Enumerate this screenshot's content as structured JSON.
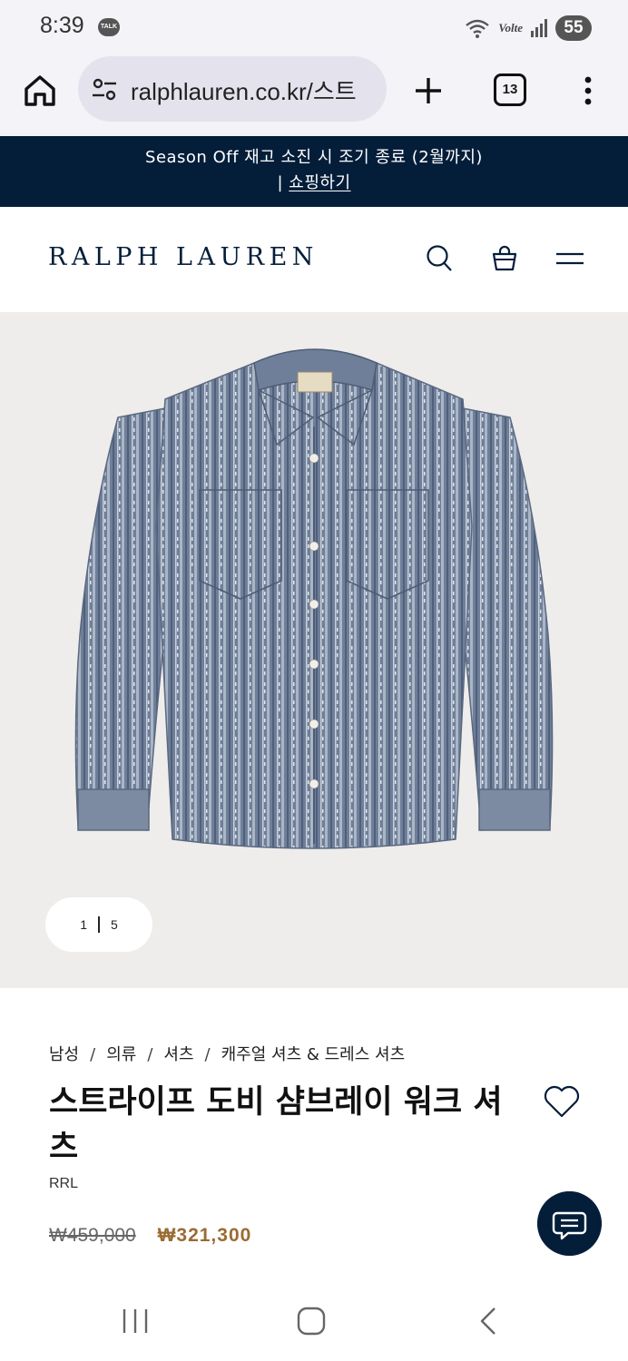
{
  "status_bar": {
    "time": "8:39",
    "talk_badge": "TALK",
    "network": "Volte",
    "battery": "55"
  },
  "browser": {
    "url": "ralphlauren.co.kr/스트",
    "tab_count": "13"
  },
  "promo": {
    "text": "Season Off 재고 소진 시 조기 종료 (2월까지)",
    "separator": "|",
    "link": "쇼핑하기"
  },
  "header": {
    "logo": "RALPH LAUREN"
  },
  "gallery": {
    "current": "1",
    "total": "5"
  },
  "product": {
    "breadcrumb": [
      "남성",
      "의류",
      "셔츠",
      "캐주얼 셔츠 & 드레스 셔츠"
    ],
    "title": "스트라이프 도비 샴브레이 워크 셔츠",
    "brand": "RRL",
    "original_price": "₩459,000",
    "sale_price": "₩321,300"
  },
  "colors": {
    "navy": "#041e3a",
    "sale": "#9a6b32",
    "gallery_bg": "#eeedeb"
  }
}
